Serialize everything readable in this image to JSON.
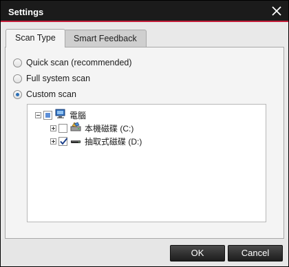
{
  "window": {
    "title": "Settings"
  },
  "tabs": [
    {
      "label": "Scan Type",
      "active": true
    },
    {
      "label": "Smart Feedback",
      "active": false
    }
  ],
  "scan_options": [
    {
      "label": "Quick scan (recommended)",
      "selected": false
    },
    {
      "label": "Full system scan",
      "selected": false
    },
    {
      "label": "Custom scan",
      "selected": true
    }
  ],
  "tree": {
    "root": {
      "label": "電腦",
      "icon": "computer-icon",
      "state": "partial",
      "expanded": true
    },
    "children": [
      {
        "label": "本機磁碟 (C:)",
        "icon": "local-disk-icon",
        "checked": false,
        "expanded": false
      },
      {
        "label": "抽取式磁碟 (D:)",
        "icon": "removable-disk-icon",
        "checked": true,
        "expanded": false
      }
    ]
  },
  "buttons": {
    "ok": "OK",
    "cancel": "Cancel"
  },
  "colors": {
    "titlebar": "#1b1b1b",
    "accent": "#c41e3a",
    "button": "#2a2a2a"
  }
}
